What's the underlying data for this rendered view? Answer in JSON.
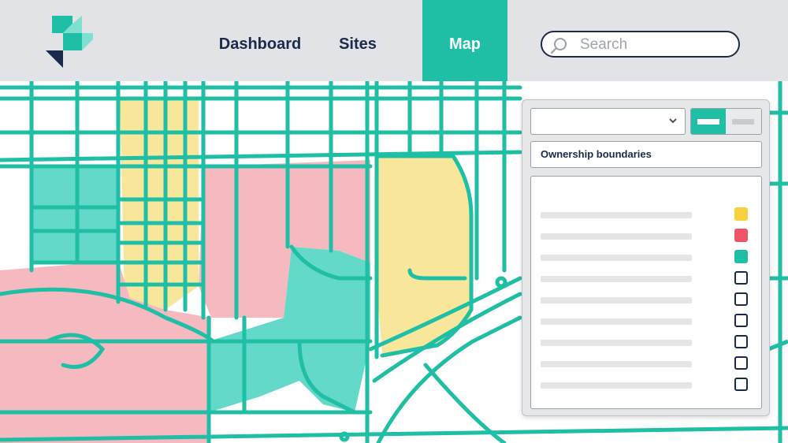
{
  "header": {
    "nav": [
      {
        "label": "Dashboard",
        "active": false
      },
      {
        "label": "Sites",
        "active": false
      },
      {
        "label": "Map",
        "active": true
      }
    ],
    "search_placeholder": "Search"
  },
  "panel": {
    "select_value": "",
    "layer_label": "Ownership boundaries",
    "legend": [
      {
        "swatch": "#f7d23e",
        "filled": true
      },
      {
        "swatch": "#ef5668",
        "filled": true
      },
      {
        "swatch": "#1ebfa4",
        "filled": true
      },
      {
        "swatch": "#ffffff",
        "filled": false
      },
      {
        "swatch": "#ffffff",
        "filled": false
      },
      {
        "swatch": "#ffffff",
        "filled": false
      },
      {
        "swatch": "#ffffff",
        "filled": false
      },
      {
        "swatch": "#ffffff",
        "filled": false
      },
      {
        "swatch": "#ffffff",
        "filled": false
      }
    ]
  },
  "colors": {
    "accent": "#1ebfa4",
    "yellow_zone": "#f8e79a",
    "pink_zone": "#f7b9c0",
    "teal_zone": "#62d9c9",
    "nav_text": "#1a2a4a"
  }
}
